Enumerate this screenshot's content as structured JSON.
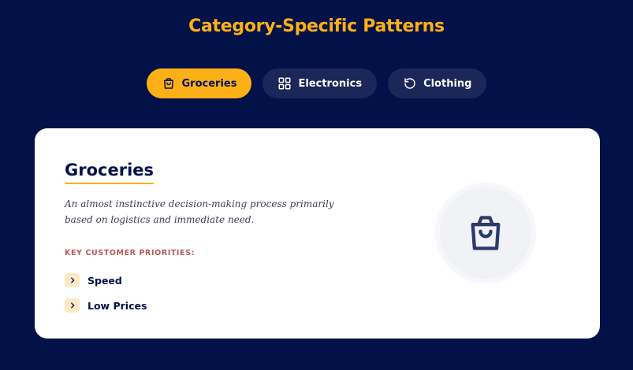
{
  "page": {
    "title": "Category-Specific Patterns"
  },
  "tabs": [
    {
      "label": "Groceries",
      "icon": "shopping-bag-icon",
      "active": true
    },
    {
      "label": "Electronics",
      "icon": "grid-icon",
      "active": false
    },
    {
      "label": "Clothing",
      "icon": "refresh-icon",
      "active": false
    }
  ],
  "card": {
    "title": "Groceries",
    "description": "An almost instinctive decision-making process primarily based on logistics and immediate need.",
    "priorities_heading": "KEY CUSTOMER PRIORITIES:",
    "priorities": [
      {
        "label": "Speed",
        "icon": "chevron-right-icon"
      },
      {
        "label": "Low Prices",
        "icon": "chevron-right-icon"
      }
    ],
    "hero_icon": "shopping-bag-icon"
  },
  "colors": {
    "background": "#031149",
    "accent": "#fbb016",
    "tab_inactive": "#1b2659",
    "card": "#ffffff",
    "heading_red": "#b65a5a",
    "chevron_bg": "#fde9c4",
    "hero_icon": "#2c3a6b"
  }
}
